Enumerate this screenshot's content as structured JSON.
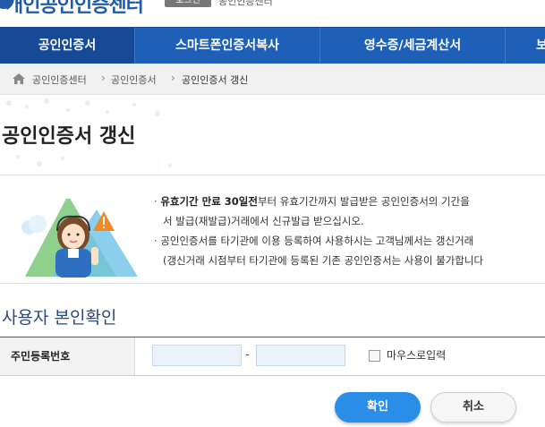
{
  "header": {
    "logo_text": "개인공인인증센터",
    "logout_label": "로그인",
    "top_link": "공인인증센터"
  },
  "gnb": {
    "items": [
      {
        "label": "공인인증서"
      },
      {
        "label": "스마트폰인증서복사"
      },
      {
        "label": "영수증/세금계산서"
      },
      {
        "label": "보"
      }
    ]
  },
  "breadcrumb": {
    "items": [
      "공인인증센터",
      "공인인증서",
      "공인인증서 갱신"
    ]
  },
  "page": {
    "title": "공인인증서 갱신"
  },
  "notice": {
    "line1_bold": "유효기간 만료 30일전",
    "line1_rest": "부터 유효기간까지 발급받은 공인인증서의 기간을",
    "line2": "서 발급(재발급)거래에서 신규발급 받으십시오.",
    "line3": "공인인증서를 타기관에 이용 등록하여 사용하시는 고객님께서는 갱신거래",
    "line4": "(갱신거래 시점부터 타기관에 등록된 기존 공인인증서는 사용이 불가합니다"
  },
  "section": {
    "title": "사용자 본인확인"
  },
  "form": {
    "ssn_label": "주민등록번호",
    "ssn_front_value": "",
    "ssn_back_value": "",
    "dash": "-",
    "mouse_input_label": "마우스로입력",
    "mouse_input_checked": false
  },
  "buttons": {
    "confirm": "확인",
    "cancel": "취소"
  },
  "colors": {
    "gnb": "#1e5fb8",
    "confirm": "#2a8ee8"
  }
}
